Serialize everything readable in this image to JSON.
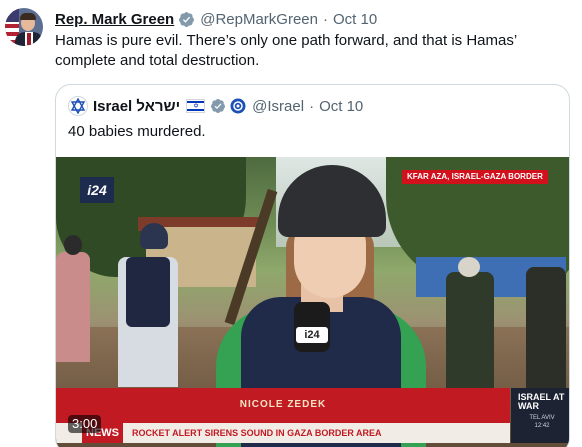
{
  "tweet": {
    "author_name": "Rep. Mark Green",
    "handle": "@RepMarkGreen",
    "separator": "·",
    "date": "Oct 10",
    "text": "Hamas is pure evil. There’s only one path forward, and that is Hamas’ complete and total destruction.",
    "avatar_icon": "profile-photo",
    "verified_icon": "verified-badge-icon",
    "verified_color": "#1d9bf0"
  },
  "quote": {
    "author_name": "Israel ישראל",
    "flag_icon": "israel-flag-icon",
    "handle": "@Israel",
    "separator": "·",
    "date": "Oct 10",
    "text": "40 babies murdered.",
    "badge_color": "#829aab",
    "video": {
      "channel_logo": "i24",
      "location_label": "KFAR AZA, ISRAEL-GAZA BORDER",
      "reporter_name": "NICOLE ZEDEK",
      "news_tag": "NEWS",
      "ticker_text": "ROCKET ALERT SIRENS SOUND IN GAZA BORDER AREA",
      "war_title": "ISRAEL AT WAR",
      "war_city": "TEL AVIV",
      "war_time": "12:42",
      "mic_label": "i24",
      "duration": "3:00"
    }
  }
}
